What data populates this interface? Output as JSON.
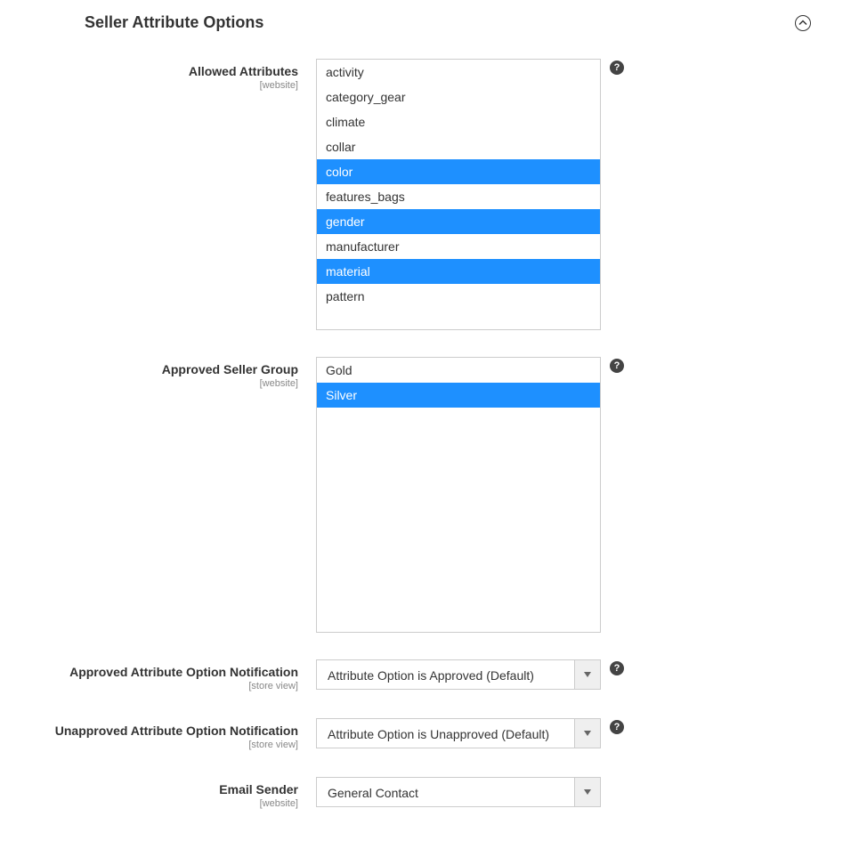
{
  "section": {
    "title": "Seller Attribute Options"
  },
  "scopes": {
    "website": "[website]",
    "store_view": "[store view]"
  },
  "fields": {
    "allowed_attributes": {
      "label": "Allowed Attributes",
      "options": [
        {
          "value": "activity",
          "selected": false
        },
        {
          "value": "category_gear",
          "selected": false
        },
        {
          "value": "climate",
          "selected": false
        },
        {
          "value": "collar",
          "selected": false
        },
        {
          "value": "color",
          "selected": true
        },
        {
          "value": "features_bags",
          "selected": false
        },
        {
          "value": "gender",
          "selected": true
        },
        {
          "value": "manufacturer",
          "selected": false
        },
        {
          "value": "material",
          "selected": true
        },
        {
          "value": "pattern",
          "selected": false
        }
      ]
    },
    "approved_seller_group": {
      "label": "Approved Seller Group",
      "options": [
        {
          "value": "Gold",
          "selected": false
        },
        {
          "value": "Silver",
          "selected": true
        }
      ]
    },
    "approved_notification": {
      "label": "Approved Attribute Option Notification",
      "value": "Attribute Option is Approved (Default)"
    },
    "unapproved_notification": {
      "label": "Unapproved Attribute Option Notification",
      "value": "Attribute Option is Unapproved (Default)"
    },
    "email_sender": {
      "label": "Email Sender",
      "value": "General Contact"
    }
  },
  "help_symbol": "?"
}
